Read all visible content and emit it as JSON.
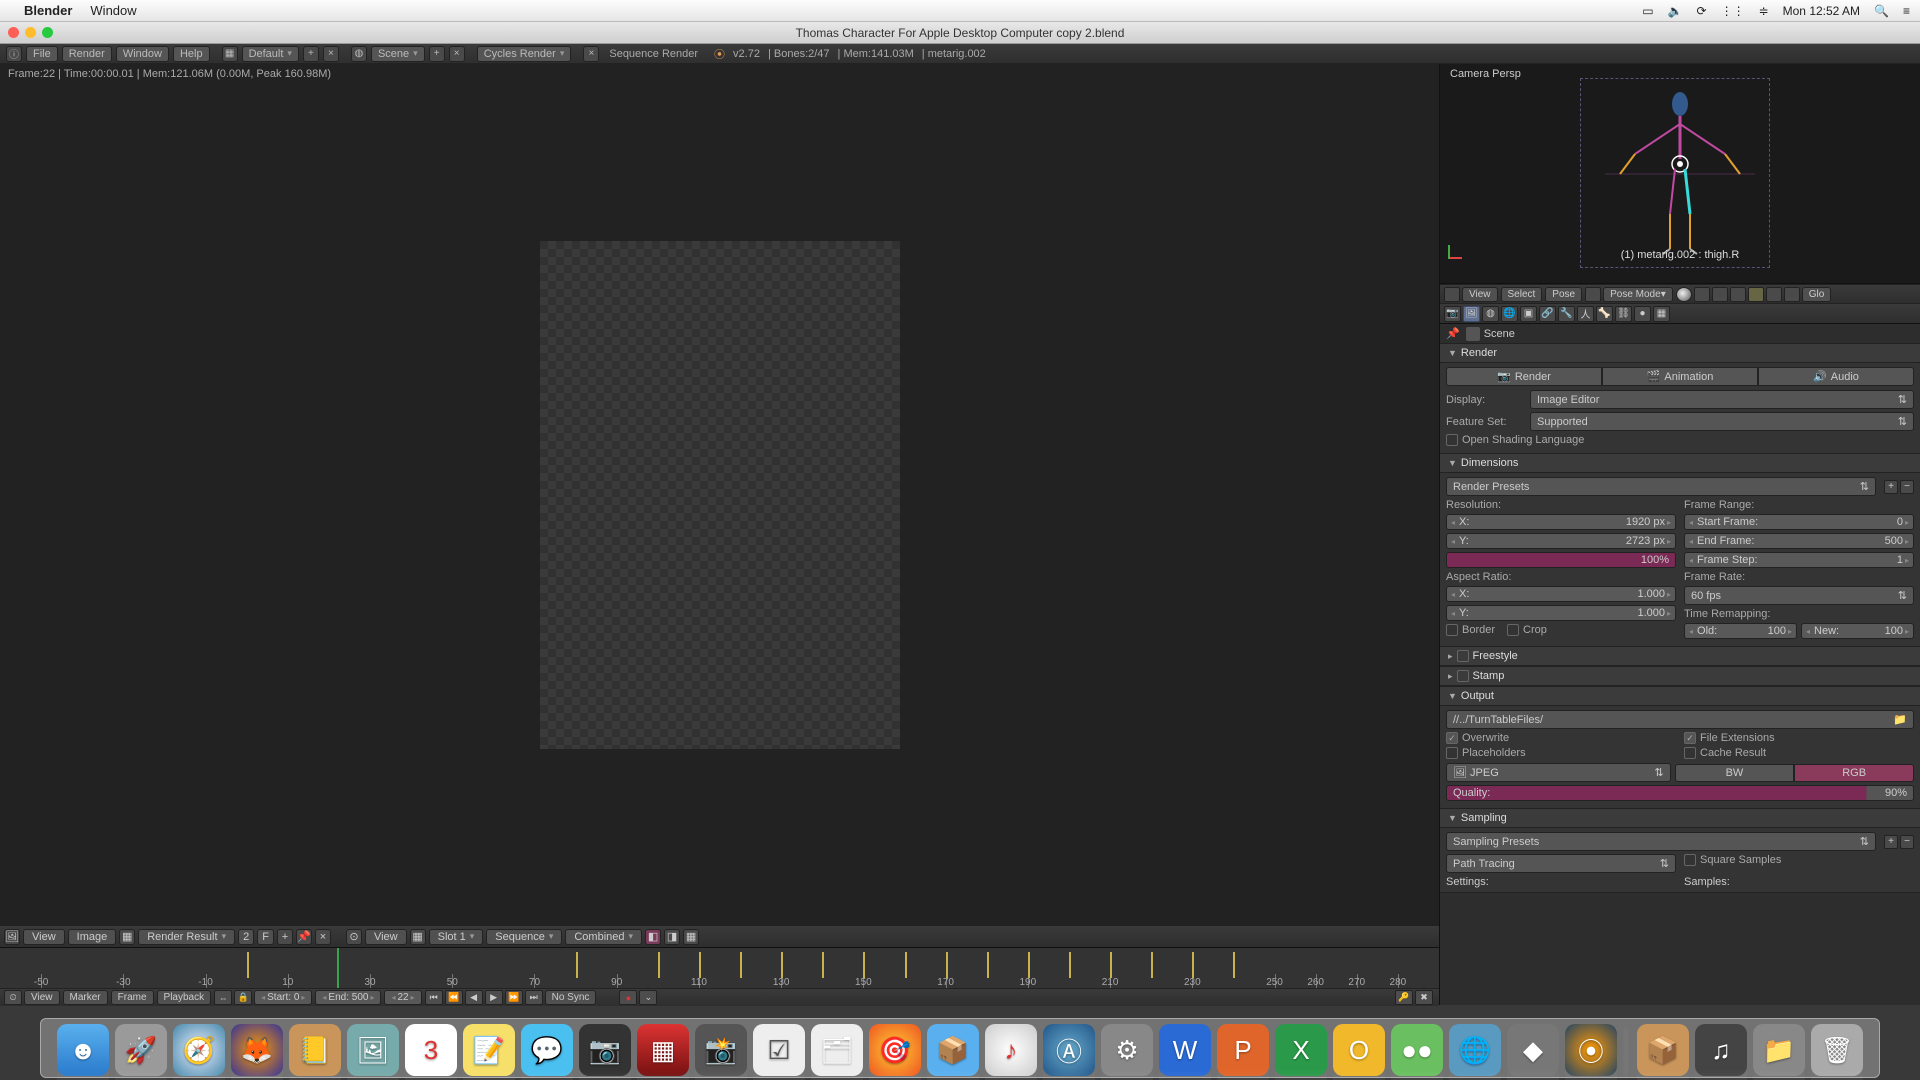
{
  "mac": {
    "appName": "Blender",
    "menu2": "Window",
    "clock": "Mon 12:52 AM"
  },
  "window": {
    "title": "Thomas Character For Apple Desktop Computer copy 2.blend"
  },
  "infobar": {
    "menus": [
      "File",
      "Render",
      "Window",
      "Help"
    ],
    "layout": "Default",
    "scene": "Scene",
    "engine": "Cycles Render",
    "seqLabel": "Sequence Render",
    "version": "v2.72",
    "bones": "Bones:2/47",
    "mem": "Mem:141.03M",
    "active": "metarig.002"
  },
  "imgEditor": {
    "status": "Frame:22 | Time:00:00.01 | Mem:121.06M (0.00M, Peak 160.98M)",
    "header": {
      "view": "View",
      "image": "Image",
      "imgblock": "Render Result",
      "two": "2",
      "f": "F",
      "view2": "View",
      "slot": "Slot 1",
      "seq": "Sequence",
      "comb": "Combined"
    }
  },
  "viewport": {
    "title": "Camera Persp",
    "objinfo": "(1) metarig.002 : thigh.R",
    "header": {
      "view": "View",
      "select": "Select",
      "pose": "Pose",
      "mode": "Pose Mode",
      "orient": "Glo"
    }
  },
  "props": {
    "crumb": "Scene",
    "render": {
      "title": "Render",
      "btnRender": "Render",
      "btnAnim": "Animation",
      "btnAudio": "Audio",
      "displayLabel": "Display:",
      "displayValue": "Image Editor",
      "featureLabel": "Feature Set:",
      "featureValue": "Supported",
      "osl": "Open Shading Language"
    },
    "dim": {
      "title": "Dimensions",
      "presets": "Render Presets",
      "resolution": "Resolution:",
      "resX": "1920 px",
      "resY": "2723 px",
      "resPct": "100%",
      "aspect": "Aspect Ratio:",
      "aspX": "1.000",
      "aspY": "1.000",
      "border": "Border",
      "crop": "Crop",
      "frameRange": "Frame Range:",
      "start": "Start Frame:",
      "startV": "0",
      "end": "End Frame:",
      "endV": "500",
      "step": "Frame Step:",
      "stepV": "1",
      "frameRate": "Frame Rate:",
      "fps": "60 fps",
      "timeRemap": "Time Remapping:",
      "old": "Old:",
      "oldV": "100",
      "new": "New:",
      "newV": "100"
    },
    "freestyle": "Freestyle",
    "stamp": "Stamp",
    "output": {
      "title": "Output",
      "path": "//../TurnTableFiles/",
      "overwrite": "Overwrite",
      "placeholders": "Placeholders",
      "fileext": "File Extensions",
      "cache": "Cache Result",
      "format": "JPEG",
      "bw": "BW",
      "rgb": "RGB",
      "quality": "Quality:",
      "qualityV": "90%"
    },
    "sampling": {
      "title": "Sampling",
      "presets": "Sampling Presets",
      "path": "Path Tracing",
      "square": "Square Samples",
      "settings": "Settings:",
      "samples": "Samples:"
    }
  },
  "timeline": {
    "header": {
      "view": "View",
      "marker": "Marker",
      "frame": "Frame",
      "playback": "Playback",
      "start": "Start:",
      "startV": "0",
      "end": "End:",
      "endV": "500",
      "cur": "22",
      "sync": "No Sync"
    },
    "ticks": [
      -50,
      -30,
      -10,
      10,
      30,
      50,
      70,
      90,
      110,
      130,
      150,
      170,
      190,
      210,
      230,
      250,
      "260",
      "270",
      "280"
    ],
    "labels": [
      -50,
      -30,
      -10,
      10,
      30,
      50,
      70,
      90,
      110,
      130,
      150,
      170,
      190,
      210,
      230,
      250,
      260,
      270,
      280
    ],
    "current": 22,
    "keys": [
      0,
      80,
      100,
      110,
      120,
      130,
      140,
      150,
      160,
      170,
      180,
      190,
      200,
      210,
      220,
      230,
      240
    ]
  }
}
